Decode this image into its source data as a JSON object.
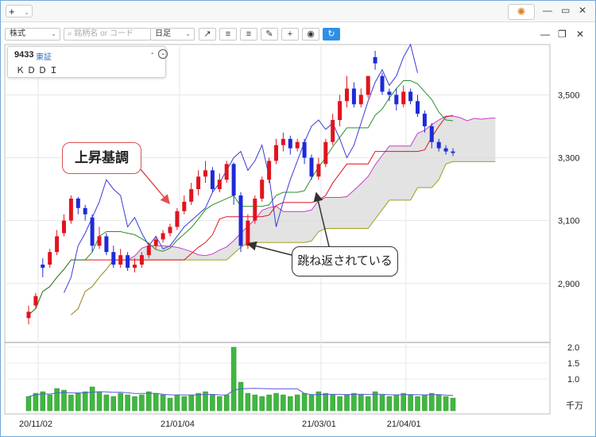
{
  "topbar": {
    "plus_label": "+",
    "chevron": "⌄",
    "gear_icon": "gear-icon",
    "minimize": "—",
    "maximize": "▭",
    "close": "✕"
  },
  "toolbar": {
    "market_select": "株式",
    "search_placeholder": "銘柄名 or コード",
    "interval_select": "日足",
    "tools": [
      "↗",
      "≡",
      "≡",
      "✎",
      "+",
      "◉",
      "↻"
    ]
  },
  "panel_controls": {
    "minimize": "—",
    "restore": "❐",
    "close": "✕"
  },
  "info": {
    "code": "9433",
    "exchange": "東証",
    "name": "ＫＤＤＩ",
    "dash": "-",
    "toggle": "⌄"
  },
  "callouts": {
    "uptrend": "上昇基調",
    "rebound": "跳ね返されている"
  },
  "chart_data": {
    "type": "candlestick",
    "price_axis": {
      "ticks": [
        2900,
        3100,
        3300,
        3500
      ],
      "labels": [
        "2,900",
        "3,100",
        "3,300",
        "3,500"
      ],
      "range": [
        2720,
        3650
      ]
    },
    "volume_axis": {
      "ticks": [
        1.0,
        1.5,
        2.0
      ],
      "labels": [
        "1.0",
        "1.5",
        "2.0"
      ],
      "unit": "千万",
      "range": [
        0,
        2.0
      ]
    },
    "x_labels": [
      "20/11/02",
      "21/01/04",
      "21/03/01",
      "21/04/01"
    ],
    "candles": [
      [
        2790,
        2810,
        2770,
        2830,
        1
      ],
      [
        2830,
        2860,
        2820,
        2870,
        1
      ],
      [
        2950,
        2960,
        2920,
        2980,
        0
      ],
      [
        2960,
        3000,
        2950,
        3010,
        1
      ],
      [
        3000,
        3050,
        2990,
        3070,
        1
      ],
      [
        3060,
        3100,
        3050,
        3120,
        1
      ],
      [
        3100,
        3170,
        3090,
        3180,
        1
      ],
      [
        3170,
        3140,
        3120,
        3175,
        0
      ],
      [
        3140,
        3120,
        3100,
        3150,
        0
      ],
      [
        3110,
        3020,
        3000,
        3120,
        0
      ],
      [
        3020,
        3050,
        3010,
        3080,
        1
      ],
      [
        3050,
        3000,
        2990,
        3060,
        0
      ],
      [
        3000,
        2960,
        2950,
        3020,
        0
      ],
      [
        2960,
        2990,
        2950,
        3010,
        1
      ],
      [
        2990,
        2950,
        2940,
        3000,
        0
      ],
      [
        2950,
        2960,
        2935,
        2980,
        1
      ],
      [
        2960,
        2990,
        2950,
        3000,
        1
      ],
      [
        2990,
        3020,
        2980,
        3030,
        1
      ],
      [
        3020,
        3040,
        3010,
        3050,
        1
      ],
      [
        3040,
        3060,
        3030,
        3070,
        1
      ],
      [
        3060,
        3080,
        3050,
        3090,
        1
      ],
      [
        3080,
        3130,
        3070,
        3140,
        1
      ],
      [
        3130,
        3160,
        3120,
        3180,
        1
      ],
      [
        3160,
        3200,
        3150,
        3220,
        1
      ],
      [
        3200,
        3240,
        3180,
        3260,
        1
      ],
      [
        3240,
        3260,
        3220,
        3290,
        1
      ],
      [
        3260,
        3200,
        3190,
        3270,
        0
      ],
      [
        3200,
        3230,
        3190,
        3250,
        1
      ],
      [
        3230,
        3280,
        3220,
        3290,
        1
      ],
      [
        3280,
        3180,
        3150,
        3285,
        0
      ],
      [
        3180,
        3020,
        3000,
        3190,
        0
      ],
      [
        3020,
        3100,
        3010,
        3120,
        1
      ],
      [
        3100,
        3170,
        3090,
        3180,
        1
      ],
      [
        3170,
        3230,
        3160,
        3240,
        1
      ],
      [
        3230,
        3290,
        3220,
        3300,
        1
      ],
      [
        3290,
        3340,
        3280,
        3360,
        1
      ],
      [
        3340,
        3360,
        3320,
        3380,
        1
      ],
      [
        3360,
        3330,
        3310,
        3370,
        0
      ],
      [
        3330,
        3350,
        3320,
        3360,
        1
      ],
      [
        3350,
        3300,
        3280,
        3360,
        0
      ],
      [
        3300,
        3240,
        3230,
        3310,
        0
      ],
      [
        3240,
        3280,
        3230,
        3300,
        1
      ],
      [
        3280,
        3350,
        3270,
        3360,
        1
      ],
      [
        3350,
        3420,
        3340,
        3440,
        1
      ],
      [
        3420,
        3480,
        3400,
        3500,
        1
      ],
      [
        3480,
        3520,
        3460,
        3560,
        1
      ],
      [
        3520,
        3470,
        3460,
        3540,
        0
      ],
      [
        3470,
        3500,
        3460,
        3520,
        1
      ],
      [
        3500,
        3560,
        3490,
        3560,
        1
      ],
      [
        3620,
        3600,
        3580,
        3640,
        0
      ],
      [
        3560,
        3510,
        3500,
        3570,
        0
      ],
      [
        3510,
        3500,
        3480,
        3520,
        0
      ],
      [
        3500,
        3470,
        3450,
        3520,
        0
      ],
      [
        3470,
        3510,
        3460,
        3530,
        1
      ],
      [
        3510,
        3480,
        3470,
        3520,
        0
      ],
      [
        3480,
        3440,
        3430,
        3500,
        0
      ],
      [
        3440,
        3400,
        3380,
        3450,
        0
      ],
      [
        3400,
        3350,
        3330,
        3410,
        0
      ],
      [
        3350,
        3330,
        3320,
        3360,
        0
      ],
      [
        3330,
        3320,
        3310,
        3340,
        0
      ],
      [
        3320,
        3315,
        3305,
        3330,
        0
      ]
    ],
    "volume": [
      0.45,
      0.55,
      0.6,
      0.5,
      0.7,
      0.65,
      0.5,
      0.55,
      0.6,
      0.75,
      0.6,
      0.5,
      0.45,
      0.55,
      0.5,
      0.45,
      0.5,
      0.6,
      0.55,
      0.5,
      0.4,
      0.5,
      0.45,
      0.5,
      0.55,
      0.6,
      0.5,
      0.45,
      0.5,
      2.0,
      0.9,
      0.55,
      0.5,
      0.45,
      0.5,
      0.55,
      0.5,
      0.45,
      0.5,
      0.55,
      0.5,
      0.6,
      0.55,
      0.5,
      0.45,
      0.5,
      0.55,
      0.5,
      0.45,
      0.6,
      0.5,
      0.45,
      0.5,
      0.55,
      0.5,
      0.45,
      0.5,
      0.55,
      0.5,
      0.45,
      0.4
    ],
    "colors": {
      "up": "#e0141e",
      "down": "#1e2ad8",
      "volume": "#3fb83f",
      "kijun": "#e0141e",
      "tenkan": "#2a8f2a",
      "chikou": "#3a3ad8",
      "span_a": "#c83cc8",
      "span_b": "#a0a020",
      "cloud": "#dcdcdc"
    }
  }
}
